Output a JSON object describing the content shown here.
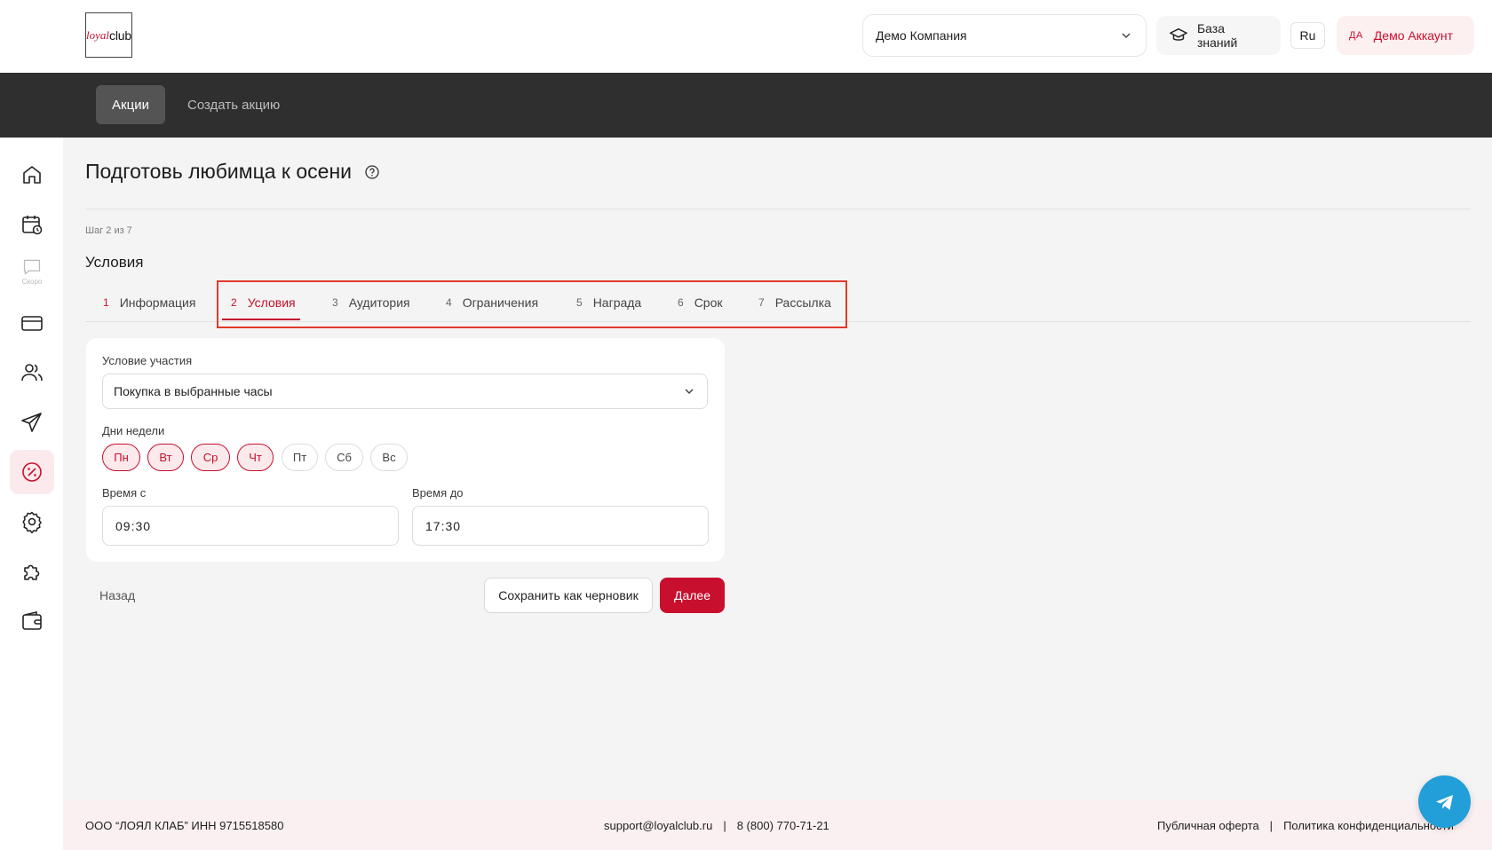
{
  "header": {
    "logo": {
      "part1": "loyal",
      "part2": "club"
    },
    "company_select": "Демо Компания",
    "knowledge_base": "База знаний",
    "language": "Ru",
    "account_initials": "ДА",
    "account_name": "Демо Аккаунт"
  },
  "topnav": {
    "tabs": [
      {
        "label": "Акции",
        "active": true
      },
      {
        "label": "Создать акцию",
        "active": false
      }
    ]
  },
  "sidebar": {
    "items": [
      {
        "icon": "home-icon"
      },
      {
        "icon": "calendar-icon"
      },
      {
        "icon": "chat-icon",
        "badge": "Скоро"
      },
      {
        "icon": "card-icon"
      },
      {
        "icon": "users-icon"
      },
      {
        "icon": "send-icon"
      },
      {
        "icon": "discount-icon",
        "active": true
      },
      {
        "icon": "gear-icon"
      },
      {
        "icon": "puzzle-icon"
      },
      {
        "icon": "wallet-icon"
      }
    ]
  },
  "page": {
    "title": "Подготовь любимца к осени",
    "step_label": "Шаг 2 из 7",
    "section_title": "Условия"
  },
  "steps": [
    {
      "num": "1",
      "label": "Информация"
    },
    {
      "num": "2",
      "label": "Условия",
      "active": true
    },
    {
      "num": "3",
      "label": "Аудитория"
    },
    {
      "num": "4",
      "label": "Ограничения"
    },
    {
      "num": "5",
      "label": "Награда"
    },
    {
      "num": "6",
      "label": "Срок"
    },
    {
      "num": "7",
      "label": "Рассылка"
    }
  ],
  "form": {
    "condition_label": "Условие участия",
    "condition_value": "Покупка в выбранные часы",
    "days_label": "Дни недели",
    "days": [
      {
        "label": "Пн",
        "selected": true
      },
      {
        "label": "Вт",
        "selected": true
      },
      {
        "label": "Ср",
        "selected": true
      },
      {
        "label": "Чт",
        "selected": true
      },
      {
        "label": "Пт",
        "selected": false
      },
      {
        "label": "Сб",
        "selected": false
      },
      {
        "label": "Вс",
        "selected": false
      }
    ],
    "time_from_label": "Время с",
    "time_from_value": "09:30",
    "time_to_label": "Время до",
    "time_to_value": "17:30"
  },
  "actions": {
    "back": "Назад",
    "save_draft": "Сохранить как черновик",
    "next": "Далее"
  },
  "footer": {
    "company": "ООО “ЛОЯЛ КЛАБ” ИНН 9715518580",
    "email": "support@loyalclub.ru",
    "separator": "|",
    "phone": "8 (800) 770-71-21",
    "offer": "Публичная оферта",
    "privacy": "Политика конфиденциальности"
  },
  "colors": {
    "accent": "#c8102e",
    "dark_nav": "#2f2f2f",
    "telegram": "#229ed9"
  }
}
